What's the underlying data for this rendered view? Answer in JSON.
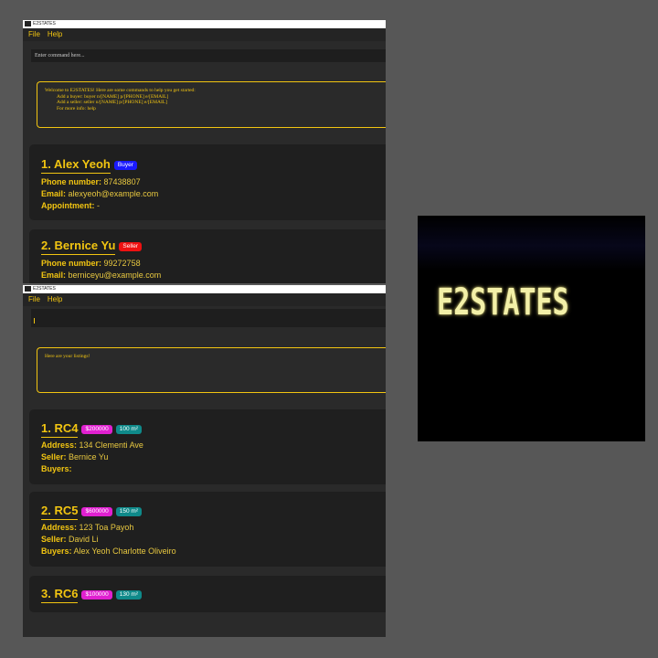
{
  "window_top": {
    "title": "E2STATES",
    "menu": {
      "file": "File",
      "help": "Help"
    },
    "command_placeholder": "Enter command here...",
    "result": {
      "line1": "Welcome to E2STATES! Here are some commands to help you get started:",
      "line2": "Add a buyer: buyer n/[NAME] p/[PHONE] e/[EMAIL]",
      "line3": "Add a seller: seller n/[NAME] p/[PHONE] e/[EMAIL]",
      "line4": "For more info: help"
    },
    "persons": [
      {
        "name": "1.  Alex Yeoh",
        "role": "Buyer",
        "role_color": "#1a1aff",
        "phone_label": "Phone number:",
        "phone": "87438807",
        "email_label": "Email:",
        "email": "alexyeoh@example.com",
        "appt_label": "Appointment:",
        "appt": "-"
      },
      {
        "name": "2.  Bernice Yu",
        "role": "Seller",
        "role_color": "#ee1111",
        "phone_label": "Phone number:",
        "phone": "99272758",
        "email_label": "Email:",
        "email": "berniceyu@example.com"
      }
    ]
  },
  "window_bottom": {
    "title": "E2STATES",
    "menu": {
      "file": "File",
      "help": "Help"
    },
    "result": "Here are your listings!",
    "listings": [
      {
        "name": "1.  RC4",
        "price": "$200000",
        "area": "100 m²",
        "address_label": "Address:",
        "address": "134 Clementi Ave",
        "seller_label": "Seller:",
        "seller": "Bernice Yu",
        "buyers_label": "Buyers:",
        "buyers": ""
      },
      {
        "name": "2.  RC5",
        "price": "$600000",
        "area": "150 m²",
        "address_label": "Address:",
        "address": "123 Toa Payoh",
        "seller_label": "Seller:",
        "seller": "David Li",
        "buyers_label": "Buyers:",
        "buyers": "Alex Yeoh  Charlotte Oliveiro"
      },
      {
        "name": "3.  RC6",
        "price": "$100000",
        "area": "130 m²"
      }
    ],
    "price_color": "#e020d0",
    "area_color": "#0f8a8a"
  },
  "preview": {
    "logo_text": "E2STATES"
  }
}
